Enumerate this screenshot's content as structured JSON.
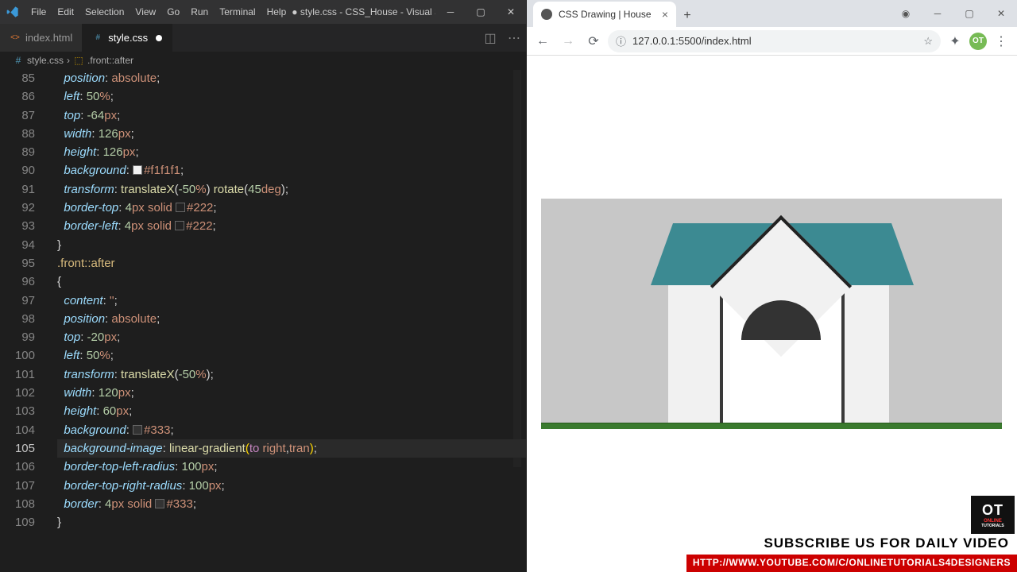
{
  "menubar": {
    "items": [
      "File",
      "Edit",
      "Selection",
      "View",
      "Go",
      "Run",
      "Terminal",
      "Help"
    ],
    "title": "● style.css - CSS_House - Visual Studio Co..."
  },
  "tabs": {
    "t0": {
      "label": "index.html",
      "icon": "<>"
    },
    "t1": {
      "label": "style.css",
      "icon": "#"
    }
  },
  "breadcrumb": {
    "file": "style.css",
    "sep": "›",
    "sel": ".front::after"
  },
  "code": {
    "lines": [
      {
        "n": "85",
        "html": "  <span class='tok-prop'>position</span><span class='tok-punc'>:</span> <span class='tok-val'>absolute</span><span class='tok-punc'>;</span>"
      },
      {
        "n": "86",
        "html": "  <span class='tok-prop'>left</span><span class='tok-punc'>:</span> <span class='tok-num'>50</span><span class='tok-unit'>%</span><span class='tok-punc'>;</span>"
      },
      {
        "n": "87",
        "html": "  <span class='tok-prop'>top</span><span class='tok-punc'>:</span> <span class='tok-num'>-64</span><span class='tok-unit'>px</span><span class='tok-punc'>;</span>"
      },
      {
        "n": "88",
        "html": "  <span class='tok-prop'>width</span><span class='tok-punc'>:</span> <span class='tok-num'>126</span><span class='tok-unit'>px</span><span class='tok-punc'>;</span>"
      },
      {
        "n": "89",
        "html": "  <span class='tok-prop'>height</span><span class='tok-punc'>:</span> <span class='tok-num'>126</span><span class='tok-unit'>px</span><span class='tok-punc'>;</span>"
      },
      {
        "n": "90",
        "html": "  <span class='tok-prop'>background</span><span class='tok-punc'>:</span> <span class='colorbox' style='background:#f1f1f1'></span><span class='tok-val'>#f1f1f1</span><span class='tok-punc'>;</span>"
      },
      {
        "n": "91",
        "html": "  <span class='tok-prop'>transform</span><span class='tok-punc'>:</span> <span class='tok-func'>translateX</span><span class='tok-punc'>(</span><span class='tok-num'>-50</span><span class='tok-unit'>%</span><span class='tok-punc'>)</span> <span class='tok-func'>rotate</span><span class='tok-punc'>(</span><span class='tok-num'>45</span><span class='tok-unit'>deg</span><span class='tok-punc'>)</span><span class='tok-punc'>;</span>"
      },
      {
        "n": "92",
        "html": "  <span class='tok-prop'>border-top</span><span class='tok-punc'>:</span> <span class='tok-num'>4</span><span class='tok-unit'>px</span> <span class='tok-val'>solid</span> <span class='colorbox' style='background:#222'></span><span class='tok-val'>#222</span><span class='tok-punc'>;</span>"
      },
      {
        "n": "93",
        "html": "  <span class='tok-prop'>border-left</span><span class='tok-punc'>:</span> <span class='tok-num'>4</span><span class='tok-unit'>px</span> <span class='tok-val'>solid</span> <span class='colorbox' style='background:#222'></span><span class='tok-val'>#222</span><span class='tok-punc'>;</span>"
      },
      {
        "n": "94",
        "html": "<span class='tok-punc'>}</span>"
      },
      {
        "n": "95",
        "html": "<span class='tok-sel'>.front::after</span>"
      },
      {
        "n": "96",
        "html": "<span class='tok-punc'>{</span>"
      },
      {
        "n": "97",
        "html": "  <span class='tok-prop'>content</span><span class='tok-punc'>:</span> <span class='tok-val'>''</span><span class='tok-punc'>;</span>"
      },
      {
        "n": "98",
        "html": "  <span class='tok-prop'>position</span><span class='tok-punc'>:</span> <span class='tok-val'>absolute</span><span class='tok-punc'>;</span>"
      },
      {
        "n": "99",
        "html": "  <span class='tok-prop'>top</span><span class='tok-punc'>:</span> <span class='tok-num'>-20</span><span class='tok-unit'>px</span><span class='tok-punc'>;</span>"
      },
      {
        "n": "100",
        "html": "  <span class='tok-prop'>left</span><span class='tok-punc'>:</span> <span class='tok-num'>50</span><span class='tok-unit'>%</span><span class='tok-punc'>;</span>"
      },
      {
        "n": "101",
        "html": "  <span class='tok-prop'>transform</span><span class='tok-punc'>:</span> <span class='tok-func'>translateX</span><span class='tok-punc'>(</span><span class='tok-num'>-50</span><span class='tok-unit'>%</span><span class='tok-punc'>)</span><span class='tok-punc'>;</span>"
      },
      {
        "n": "102",
        "html": "  <span class='tok-prop'>width</span><span class='tok-punc'>:</span> <span class='tok-num'>120</span><span class='tok-unit'>px</span><span class='tok-punc'>;</span>"
      },
      {
        "n": "103",
        "html": "  <span class='tok-prop'>height</span><span class='tok-punc'>:</span> <span class='tok-num'>60</span><span class='tok-unit'>px</span><span class='tok-punc'>;</span>"
      },
      {
        "n": "104",
        "html": "  <span class='tok-prop'>background</span><span class='tok-punc'>:</span> <span class='colorbox' style='background:#333'></span><span class='tok-val'>#333</span><span class='tok-punc'>;</span>"
      },
      {
        "n": "105",
        "cur": true,
        "html": "  <span class='tok-prop'>background-image</span><span class='tok-punc'>:</span> <span class='tok-func'>linear-gradient</span><span class='tok-br'>(</span><span class='tok-kw'>to</span> <span class='tok-val'>right</span><span class='tok-punc'>,</span><span class='tok-val'>tran</span><span class='tok-br'>)</span><span class='tok-punc'>;</span>"
      },
      {
        "n": "106",
        "html": "  <span class='tok-prop'>border-top-left-radius</span><span class='tok-punc'>:</span> <span class='tok-num'>100</span><span class='tok-unit'>px</span><span class='tok-punc'>;</span>"
      },
      {
        "n": "107",
        "html": "  <span class='tok-prop'>border-top-right-radius</span><span class='tok-punc'>:</span> <span class='tok-num'>100</span><span class='tok-unit'>px</span><span class='tok-punc'>;</span>"
      },
      {
        "n": "108",
        "html": "  <span class='tok-prop'>border</span><span class='tok-punc'>:</span> <span class='tok-num'>4</span><span class='tok-unit'>px</span> <span class='tok-val'>solid</span> <span class='colorbox' style='background:#333'></span><span class='tok-val'>#333</span><span class='tok-punc'>;</span>"
      },
      {
        "n": "109",
        "html": "<span class='tok-punc'>}</span>"
      }
    ]
  },
  "browser": {
    "tab_title": "CSS Drawing | House",
    "url": "127.0.0.1:5500/index.html",
    "avatar": "OT"
  },
  "banners": {
    "logo_big": "OT",
    "logo_small1": "ONLINE",
    "logo_small2": "TUTORIALS",
    "line1": "SUBSCRIBE US FOR DAILY VIDEO",
    "line2": "HTTP://WWW.YOUTUBE.COM/C/ONLINETUTORIALS4DESIGNERS"
  }
}
